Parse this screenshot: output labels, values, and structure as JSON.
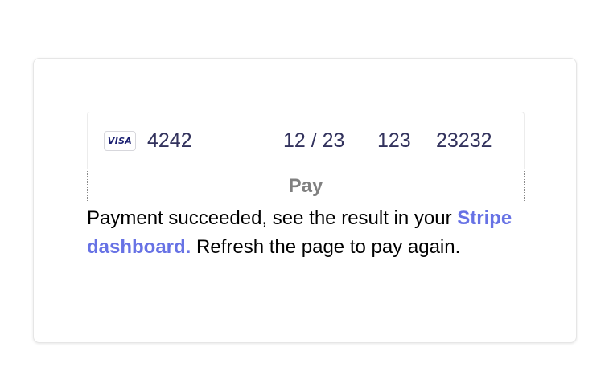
{
  "card_input": {
    "brand_icon": "visa-card-icon",
    "brand_label": "VISA",
    "card_number": "4242",
    "expiry": "12 / 23",
    "cvc": "123",
    "postal_code": "23232"
  },
  "pay_button": {
    "label": "Pay"
  },
  "result": {
    "text_before": "Payment succeeded, see the result in your ",
    "link_text": "Stripe dashboard.",
    "text_after": " Refresh the page to pay again."
  },
  "colors": {
    "link": "#6772e5",
    "input_text": "#32325d",
    "button_text": "#808080"
  }
}
